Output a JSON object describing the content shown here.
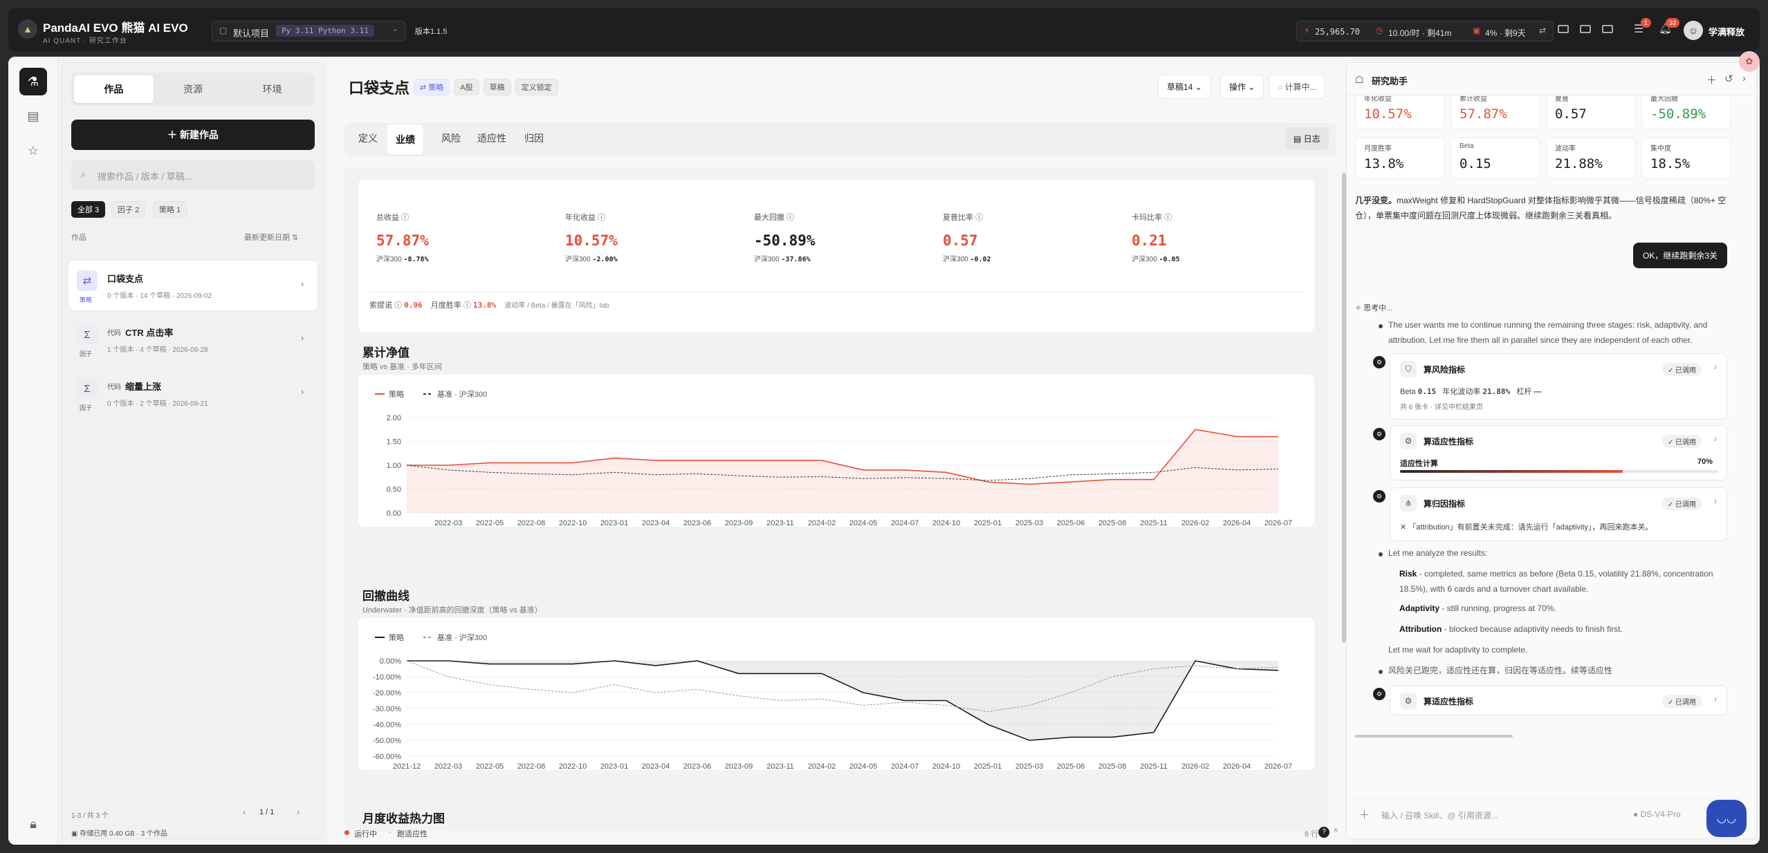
{
  "topbar": {
    "app_name": "PandaAI EVO 熊猫 AI EVO",
    "app_sub": "AI QUANT · 研究工作台",
    "project": "默认项目",
    "py_tag": "Py 3.11",
    "py_full": "Python 3.11",
    "version": "版本1.1.5",
    "credits": "25,965.70",
    "rate": "10.00/时 · 剩41m",
    "quota": "4% · 剩9天",
    "badge_a": "1",
    "badge_b": "33",
    "user": "学满释放"
  },
  "left": {
    "tabs": [
      "作品",
      "资源",
      "环境"
    ],
    "new_button": "新建作品",
    "search_placeholder": "搜索作品 / 版本 / 草稿...",
    "filters": [
      {
        "label": "全部",
        "count": "3"
      },
      {
        "label": "因子",
        "count": "2"
      },
      {
        "label": "策略",
        "count": "1"
      }
    ],
    "list_header": "作品",
    "sort_label": "最新更新日期",
    "items": [
      {
        "title": "口袋支点",
        "tag": "",
        "meta": "0 个版本 · 14 个草稿 · 2026-09-02",
        "kind": "策略",
        "icon": "strategy-icon"
      },
      {
        "title": "CTR 点击率",
        "tag": "代码",
        "meta": "1 个版本 · 4 个草稿 · 2026-08-28",
        "kind": "因子",
        "icon": "sigma-icon"
      },
      {
        "title": "缩量上涨",
        "tag": "代码",
        "meta": "0 个版本 · 2 个草稿 · 2026-08-21",
        "kind": "因子",
        "icon": "sigma-icon"
      }
    ],
    "pagination_info": "1-3 / 共 3 个",
    "page": "1 / 1",
    "storage": "存储已用 0.40 GB · 3 个作品"
  },
  "main": {
    "title": "口袋支点",
    "tags": [
      "策略",
      "A股",
      "草稿",
      "定义锁定"
    ],
    "draft_btn": "草稿14",
    "ops_btn": "操作",
    "compute_btn": "计算中...",
    "tabs": [
      "定义",
      "业绩",
      "风险",
      "适应性",
      "归因"
    ],
    "log_btn": "日志",
    "metrics": [
      {
        "label": "总收益",
        "value": "57.87%",
        "bench_label": "沪深300",
        "bench": "-8.78%",
        "color": "red"
      },
      {
        "label": "年化收益",
        "value": "10.57%",
        "bench_label": "沪深300",
        "bench": "-2.00%",
        "color": "red"
      },
      {
        "label": "最大回撤",
        "value": "-50.89%",
        "bench_label": "沪深300",
        "bench": "-37.86%",
        "color": "dark"
      },
      {
        "label": "夏普比率",
        "value": "0.57",
        "bench_label": "沪深300",
        "bench": "-0.02",
        "color": "red"
      },
      {
        "label": "卡玛比率",
        "value": "0.21",
        "bench_label": "沪深300",
        "bench": "-0.05",
        "color": "red"
      }
    ],
    "sortino_label": "索提诺",
    "sortino": "0.96",
    "winrate_label": "月度胜率",
    "winrate": "13.8%",
    "note": "波动率 / Beta / 暴露在「风险」tab",
    "nav_title": "累计净值",
    "nav_sub": "策略 vs 基准 · 多年区间",
    "dd_title": "回撤曲线",
    "dd_sub": "Underwater · 净值距前高的回撤深度（策略 vs 基准）",
    "heat_title": "月度收益热力图",
    "status": "运行中",
    "status_detail": "跑适应性",
    "lines": "8 行"
  },
  "chart_data": [
    {
      "type": "line",
      "title": "累计净值",
      "x": [
        "2021-12",
        "2022-03",
        "2022-05",
        "2022-08",
        "2022-10",
        "2023-01",
        "2023-04",
        "2023-06",
        "2023-09",
        "2023-11",
        "2024-02",
        "2024-05",
        "2024-07",
        "2024-10",
        "2025-01",
        "2025-03",
        "2025-06",
        "2025-08",
        "2025-11",
        "2026-02",
        "2026-04",
        "2026-07"
      ],
      "xticks": [
        "2022-03",
        "2022-05",
        "2022-08",
        "2022-10",
        "2023-01",
        "2023-04",
        "2023-06",
        "2023-09",
        "2023-11",
        "2024-02",
        "2024-05",
        "2024-07",
        "2024-10",
        "2025-01",
        "2025-03",
        "2025-06",
        "2025-08",
        "2025-11",
        "2026-02",
        "2026-04",
        "2026-07"
      ],
      "yticks": [
        "0.00",
        "0.50",
        "1.00",
        "1.50",
        "2.00"
      ],
      "ylim": [
        0,
        2
      ],
      "series": [
        {
          "name": "策略",
          "values": [
            1.0,
            1.0,
            1.05,
            1.05,
            1.05,
            1.15,
            1.1,
            1.1,
            1.1,
            1.1,
            1.1,
            0.9,
            0.9,
            0.85,
            0.65,
            0.6,
            0.65,
            0.7,
            0.7,
            1.75,
            1.6,
            1.6
          ],
          "color": "#e8503a"
        },
        {
          "name": "基准 · 沪深300",
          "values": [
            1.0,
            0.9,
            0.85,
            0.82,
            0.8,
            0.85,
            0.8,
            0.82,
            0.78,
            0.75,
            0.76,
            0.72,
            0.74,
            0.72,
            0.68,
            0.72,
            0.8,
            0.82,
            0.85,
            0.95,
            0.9,
            0.92
          ],
          "color": "#333333"
        }
      ],
      "legend": "top-left"
    },
    {
      "type": "line",
      "title": "回撤曲线",
      "x": [
        "2021-12",
        "2022-03",
        "2022-05",
        "2022-08",
        "2022-10",
        "2023-01",
        "2023-04",
        "2023-06",
        "2023-09",
        "2023-11",
        "2024-02",
        "2024-05",
        "2024-07",
        "2024-10",
        "2025-01",
        "2025-03",
        "2025-06",
        "2025-08",
        "2025-11",
        "2026-02",
        "2026-04",
        "2026-07"
      ],
      "xticks": [
        "2021-12",
        "2022-03",
        "2022-05",
        "2022-08",
        "2022-10",
        "2023-01",
        "2023-04",
        "2023-06",
        "2023-09",
        "2023-11",
        "2024-02",
        "2024-05",
        "2024-07",
        "2024-10",
        "2025-01",
        "2025-03",
        "2025-06",
        "2025-08",
        "2025-11",
        "2026-02",
        "2026-04",
        "2026-07"
      ],
      "yticks": [
        "0.00%",
        "-10.00%",
        "-20.00%",
        "-30.00%",
        "-40.00%",
        "-50.00%",
        "-60.00%"
      ],
      "ylim": [
        -60,
        0
      ],
      "series": [
        {
          "name": "策略",
          "values": [
            0,
            0,
            -2,
            -2,
            -2,
            0,
            -3,
            0,
            -8,
            -8,
            -8,
            -20,
            -25,
            -25,
            -40,
            -50,
            -48,
            -48,
            -45,
            0,
            -5,
            -6
          ],
          "color": "#1c1c1e"
        },
        {
          "name": "基准 · 沪深300",
          "values": [
            0,
            -10,
            -15,
            -18,
            -20,
            -15,
            -20,
            -18,
            -22,
            -25,
            -24,
            -28,
            -26,
            -28,
            -32,
            -28,
            -20,
            -10,
            -5,
            -3,
            -5,
            -4
          ],
          "color": "#999999"
        }
      ],
      "legend": "top-left"
    }
  ],
  "assistant": {
    "title": "研究助手",
    "cards_top": [
      {
        "label": "年化收益",
        "value": "10.57%",
        "color": "red"
      },
      {
        "label": "累计收益",
        "value": "57.87%",
        "color": "red"
      },
      {
        "label": "夏普",
        "value": "0.57",
        "color": "dark"
      },
      {
        "label": "最大回撤",
        "value": "-50.89%",
        "color": "green"
      }
    ],
    "cards_bottom": [
      {
        "label": "月度胜率",
        "value": "13.8%"
      },
      {
        "label": "Beta",
        "value": "0.15"
      },
      {
        "label": "波动率",
        "value": "21.88%"
      },
      {
        "label": "集中度",
        "value": "18.5%"
      }
    ],
    "summary_bold": "几乎没变。",
    "summary": "maxWeight 修复和 HardStopGuard 对整体指标影响微乎其微——信号极度稀疏（80%+ 空仓），单票集中度问题在回测尺度上体现微弱。继续跑剩余三关看真相。",
    "user_msg": "OK，继续跑剩余3关",
    "thinking": "思考中...",
    "reason": "The user wants me to continue running the remaining three stages: risk, adaptivity, and attribution. Let me fire them all in parallel since they are independent of each other.",
    "tool1": {
      "title": "算风险指标",
      "called": "已调用",
      "line_a": "Beta",
      "beta": "0.15",
      "line_b": "年化波动率",
      "vol": "21.88%",
      "line_c": "杠杆",
      "lev": "—",
      "note": "共 6 张卡 · 详见中栏结果页"
    },
    "tool2": {
      "title": "算适应性指标",
      "called": "已调用",
      "progress_label": "适应性计算",
      "progress": "70%",
      "progress_value": 0.7
    },
    "tool3": {
      "title": "算归因指标",
      "called": "已调用",
      "error": "「attribution」有前置关未完成：请先运行「adaptivity」，再回来跑本关。"
    },
    "analyze": "Let me analyze the results:",
    "r1_b": "Risk",
    "r1": " - completed, same metrics as before (Beta 0.15, volatility 21.88%, concentration 18.5%), with 6 cards and a turnover chart available.",
    "r2_b": "Adaptivity",
    "r2": " - still running, progress at 70%.",
    "r3_b": "Attribution",
    "r3": " - blocked because adaptivity needs to finish first.",
    "wait": "Let me wait for adaptivity to complete.",
    "cn_note": "风险关已跑完，适应性还在算，归因在等适应性。续等适应性",
    "tool4": {
      "title": "算适应性指标",
      "called": "已调用"
    },
    "input_placeholder": "输入 / 召唤 Skill、@ 引用资源...",
    "model": "DS-V4-Pro"
  }
}
